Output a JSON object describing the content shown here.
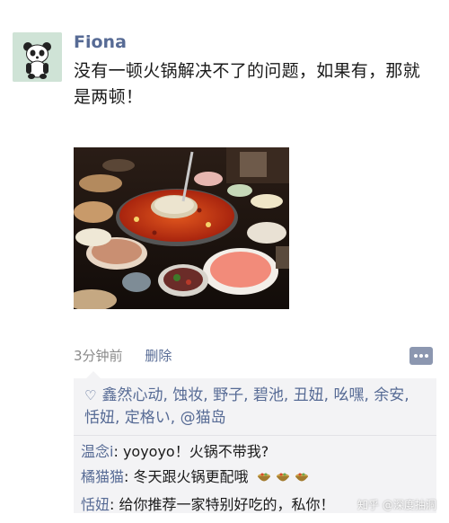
{
  "post": {
    "author": "Fiona",
    "text": "没有一顿火锅解决不了的问题，如果有，那就是两顿！",
    "time": "3分钟前",
    "delete_label": "删除"
  },
  "likes": {
    "names": "鑫然心动, 蚀妆, 野子, 碧池, 丑妞, 吆嘿, 余安, 恬妞, 定格い, @猫岛"
  },
  "comments": [
    {
      "name": "温念i",
      "sep": ": ",
      "text": "yoyoyo！火锅不带我?"
    },
    {
      "name": "橘猫猫",
      "sep": ": ",
      "text": "冬天跟火锅更配哦"
    },
    {
      "name": "恬妞",
      "sep": ": ",
      "text": "给你推荐一家特别好吃的，私你！"
    }
  ],
  "watermark": "知乎 @深度抽洞",
  "colors": {
    "link": "#576b95",
    "panel": "#f3f3f5",
    "avatar_bg": "#cfe3d6"
  }
}
